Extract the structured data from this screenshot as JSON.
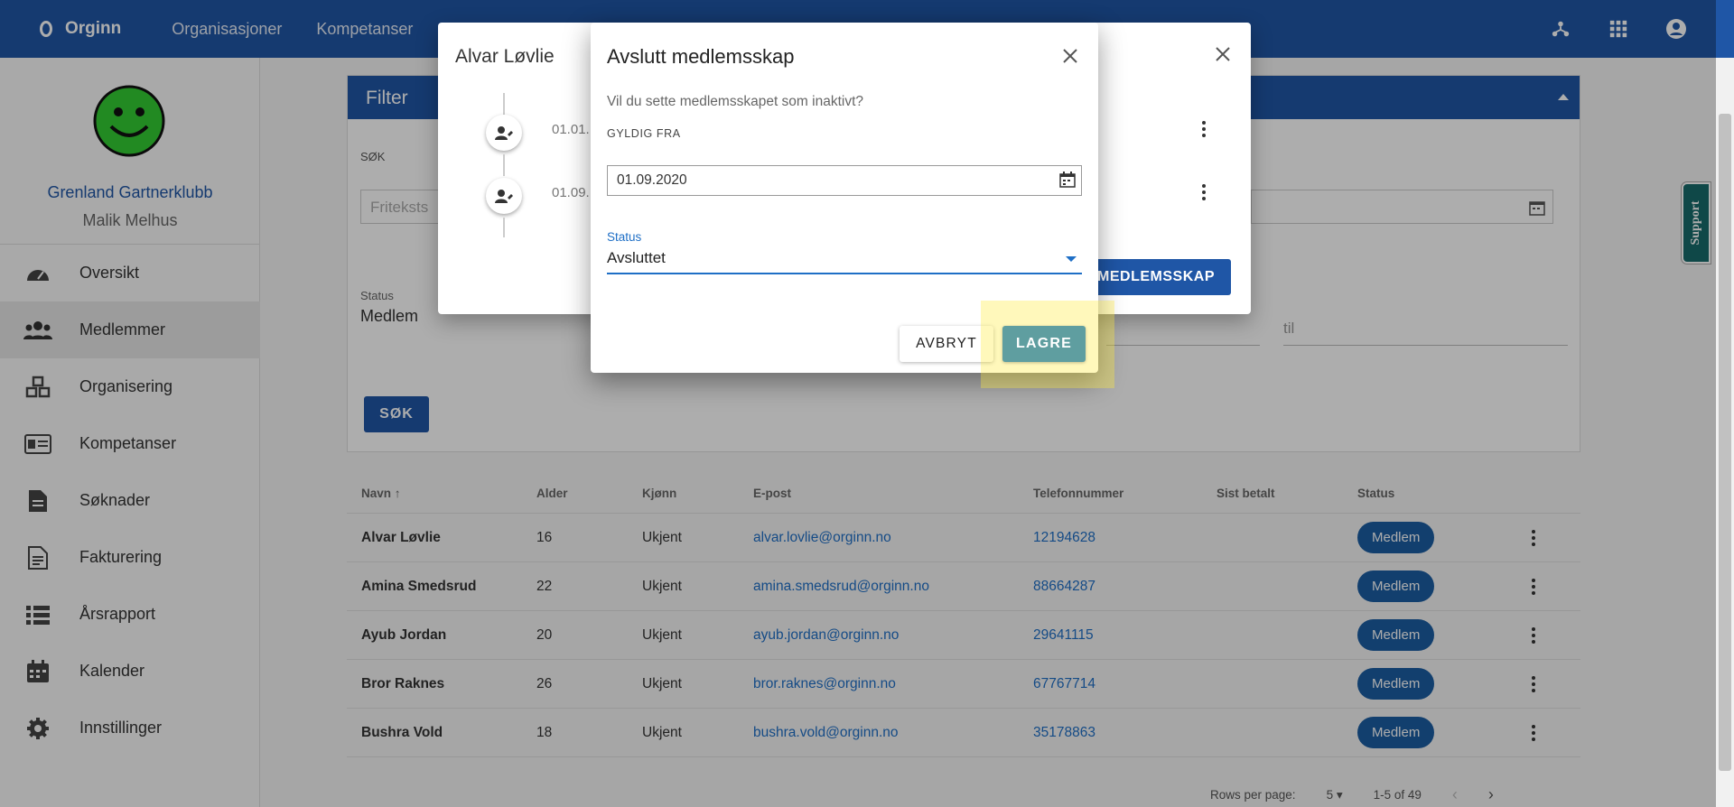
{
  "app": {
    "name": "Orginn"
  },
  "topnav": {
    "items": [
      "Organisasjoner",
      "Kompetanser"
    ]
  },
  "topicons": [
    "network-icon",
    "apps-grid-icon",
    "account-icon"
  ],
  "sidebar": {
    "club": "Grenland Gartnerklubb",
    "user": "Malik Melhus",
    "items": [
      {
        "label": "Oversikt",
        "icon": "dashboard-icon"
      },
      {
        "label": "Medlemmer",
        "icon": "people-icon",
        "active": true
      },
      {
        "label": "Organisering",
        "icon": "organisation-icon"
      },
      {
        "label": "Kompetanser",
        "icon": "id-card-icon"
      },
      {
        "label": "Søknader",
        "icon": "document-icon"
      },
      {
        "label": "Fakturering",
        "icon": "invoice-icon"
      },
      {
        "label": "Årsrapport",
        "icon": "list-icon"
      },
      {
        "label": "Kalender",
        "icon": "calendar-icon"
      },
      {
        "label": "Innstillinger",
        "icon": "gear-icon"
      }
    ]
  },
  "filter": {
    "title": "Filter",
    "search_label": "SØK",
    "search_placeholder": "Friteksts",
    "status_label": "Status",
    "status_value": "Medlem",
    "til_placeholder": "til",
    "search_button": "SØK"
  },
  "table": {
    "headers": [
      "Navn",
      "Alder",
      "Kjønn",
      "E-post",
      "Telefonnummer",
      "Sist betalt",
      "Status"
    ],
    "rows": [
      {
        "name": "Alvar Løvlie",
        "age": "16",
        "gender": "Ukjent",
        "email": "alvar.lovlie@orginn.no",
        "phone": "12194628",
        "paid": "",
        "status": "Medlem"
      },
      {
        "name": "Amina Smedsrud",
        "age": "22",
        "gender": "Ukjent",
        "email": "amina.smedsrud@orginn.no",
        "phone": "88664287",
        "paid": "",
        "status": "Medlem"
      },
      {
        "name": "Ayub Jordan",
        "age": "20",
        "gender": "Ukjent",
        "email": "ayub.jordan@orginn.no",
        "phone": "29641115",
        "paid": "",
        "status": "Medlem"
      },
      {
        "name": "Bror Raknes",
        "age": "26",
        "gender": "Ukjent",
        "email": "bror.raknes@orginn.no",
        "phone": "67767714",
        "paid": "",
        "status": "Medlem"
      },
      {
        "name": "Bushra Vold",
        "age": "18",
        "gender": "Ukjent",
        "email": "bushra.vold@orginn.no",
        "phone": "35178863",
        "paid": "",
        "status": "Medlem"
      }
    ],
    "pager": {
      "rows_label": "Rows per page:",
      "rows_value": "5",
      "range": "1-5 of 49"
    }
  },
  "support": {
    "label": "Support",
    "color": "#176b6b"
  },
  "back_dialog": {
    "title": "Alvar Løvlie",
    "entries": [
      "01.01.",
      "01.09."
    ],
    "button": "MEDLEMSSKAP"
  },
  "dialog": {
    "title": "Avslutt medlemsskap",
    "question": "Vil du sette medlemsskapet som inaktivt?",
    "valid_from_label": "GYLDIG FRA",
    "valid_from_value": "01.09.2020",
    "status_label": "Status",
    "status_value": "Avsluttet",
    "cancel": "AVBRYT",
    "save": "LAGRE"
  },
  "colors": {
    "primary": "#1f56a6",
    "save": "#5f9ea0",
    "highlight": "#ffeb3b"
  }
}
